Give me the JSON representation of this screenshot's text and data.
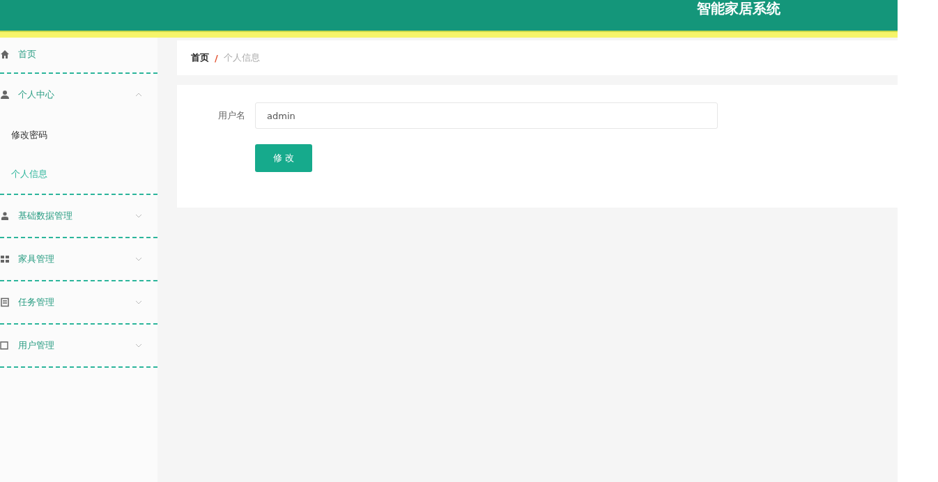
{
  "header": {
    "title": "智能家居系统"
  },
  "sidebar": {
    "items": [
      {
        "label": "首页"
      },
      {
        "label": "个人中心",
        "expanded": true,
        "children": [
          {
            "label": "修改密码",
            "selected": false
          },
          {
            "label": "个人信息",
            "selected": true
          }
        ]
      },
      {
        "label": "基础数据管理",
        "expanded": false
      },
      {
        "label": "家具管理",
        "expanded": false
      },
      {
        "label": "任务管理",
        "expanded": false
      },
      {
        "label": "用户管理",
        "expanded": false
      }
    ]
  },
  "breadcrumb": {
    "separator": "/",
    "items": [
      {
        "label": "首页",
        "current": false
      },
      {
        "label": "个人信息",
        "current": true
      }
    ]
  },
  "form": {
    "fields": [
      {
        "label": "用户名",
        "value": "admin"
      }
    ],
    "submit": "修 改"
  }
}
